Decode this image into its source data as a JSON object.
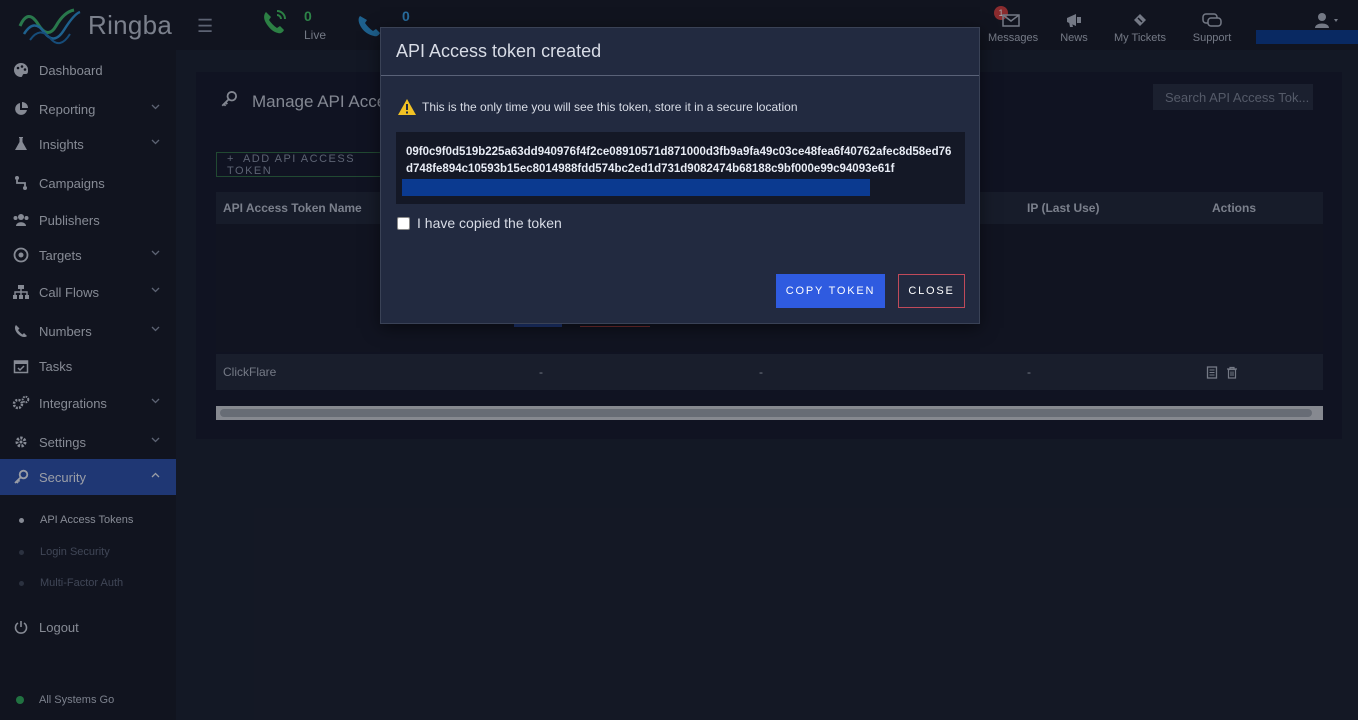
{
  "brand": {
    "name": "Ringba"
  },
  "topbar": {
    "live_count": "0",
    "live_label": "Live",
    "calls_count": "0",
    "messages_badge": "1",
    "nav": [
      {
        "label": "Messages",
        "icon": "envelope-icon"
      },
      {
        "label": "News",
        "icon": "megaphone-icon"
      },
      {
        "label": "My Tickets",
        "icon": "ticket-icon"
      },
      {
        "label": "Support",
        "icon": "chat-icon"
      }
    ]
  },
  "sidebar": {
    "items": [
      {
        "label": "Dashboard",
        "icon": "palette-icon"
      },
      {
        "label": "Reporting",
        "icon": "pie-chart-icon"
      },
      {
        "label": "Insights",
        "icon": "flask-icon"
      },
      {
        "label": "Campaigns",
        "icon": "route-icon"
      },
      {
        "label": "Publishers",
        "icon": "users-icon"
      },
      {
        "label": "Targets",
        "icon": "target-icon"
      },
      {
        "label": "Call Flows",
        "icon": "sitemap-icon"
      },
      {
        "label": "Numbers",
        "icon": "phone-icon"
      },
      {
        "label": "Tasks",
        "icon": "calendar-check-icon"
      },
      {
        "label": "Integrations",
        "icon": "cogs-icon"
      },
      {
        "label": "Settings",
        "icon": "gear-icon"
      },
      {
        "label": "Security",
        "icon": "key-icon"
      }
    ],
    "security_sub": [
      {
        "label": "API Access Tokens"
      },
      {
        "label": "Login Security"
      },
      {
        "label": "Multi-Factor Auth"
      }
    ],
    "logout": "Logout",
    "status": "All Systems Go"
  },
  "page": {
    "title": "Manage API Access Tokens",
    "search_placeholder": "Search API Access Tok...",
    "add_button": "ADD API ACCESS TOKEN",
    "columns": [
      "API Access Token Name",
      "IP (Last Use)",
      "Actions"
    ],
    "rows": [
      {
        "name": "ClickFlare",
        "c1": "-",
        "c2": "-",
        "c3": "-"
      }
    ]
  },
  "modal": {
    "title": "API Access token created",
    "warning": "This is the only time you will see this token, store it in a secure location",
    "token": "09f0c9f0d519b225a63dd940976f4f2ce08910571d871000d3fb9a9fa49c03ce48fea6f40762afec8d58ed76d748fe894c10593b15ec8014988fdd574bc2ed1d731d9082474b68188c9bf000e99c94093e61f",
    "checkbox_label": "I have copied the token",
    "copy_button": "COPY TOKEN",
    "close_button": "CLOSE"
  },
  "colors": {
    "accent": "#2f5be0",
    "active_nav": "#2b4fa8",
    "live_green": "#41c464",
    "danger": "#c04a5a"
  }
}
